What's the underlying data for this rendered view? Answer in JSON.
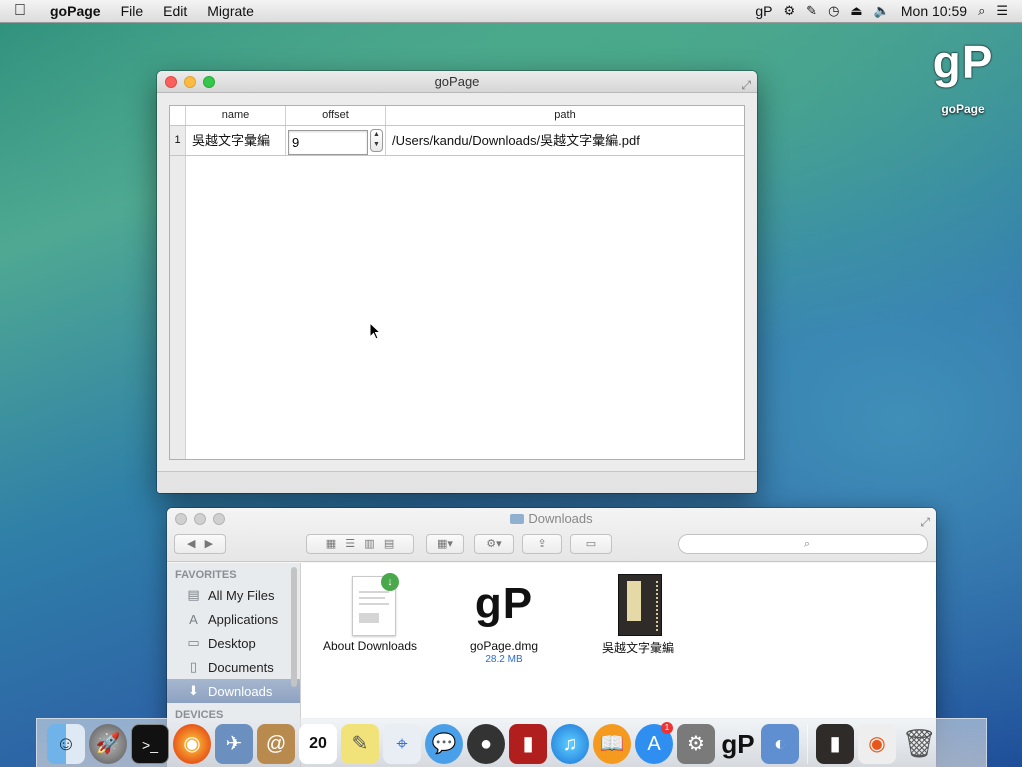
{
  "menubar": {
    "app_name": "goPage",
    "items": [
      "File",
      "Edit",
      "Migrate"
    ],
    "status_app": "gP",
    "clock": "Mon 10:59"
  },
  "desktop": {
    "icon_glyph": "gP",
    "icon_label": "goPage"
  },
  "gopage_window": {
    "title": "goPage",
    "columns": [
      "name",
      "offset",
      "path"
    ],
    "rows": [
      {
        "index": "1",
        "name": "吳越文字彙編",
        "offset": "9",
        "path": "/Users/kandu/Downloads/吳越文字彙編.pdf"
      }
    ],
    "stepper_up": "▲",
    "stepper_down": "▼"
  },
  "finder": {
    "title": "Downloads",
    "search_placeholder": "",
    "sidebar_heading": "FAVORITES",
    "sidebar_items": [
      {
        "label": "All My Files",
        "icon": "all-files-icon",
        "glyph": "▤"
      },
      {
        "label": "Applications",
        "icon": "applications-icon",
        "glyph": "A"
      },
      {
        "label": "Desktop",
        "icon": "desktop-icon",
        "glyph": "▭"
      },
      {
        "label": "Documents",
        "icon": "documents-icon",
        "glyph": "▯"
      },
      {
        "label": "Downloads",
        "icon": "downloads-icon",
        "glyph": "⬇"
      }
    ],
    "sidebar_next_heading": "DEVICES",
    "files": [
      {
        "name": "About Downloads",
        "sub": ""
      },
      {
        "name": "goPage.dmg",
        "sub": "28.2 MB",
        "glyph": "gP"
      },
      {
        "name": "吳越文字彙編",
        "sub": ""
      }
    ]
  },
  "dock": {
    "app_store_badge": "1",
    "calendar_day": "20",
    "gopage_glyph": "gP"
  },
  "colors": {
    "close": "#fc605c",
    "minimize": "#fdbc40",
    "zoom": "#34c84a",
    "selection": "#8da2c2",
    "link_blue": "#2a6cc8"
  }
}
